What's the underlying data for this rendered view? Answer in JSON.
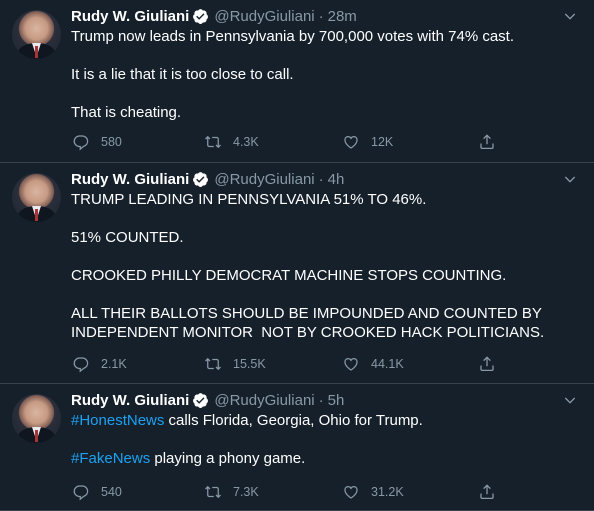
{
  "tweets": [
    {
      "name": "Rudy W. Giuliani",
      "handle": "@RudyGiuliani",
      "dot": "·",
      "time": "28m",
      "paragraphs": [
        [
          {
            "text": "Trump now leads in Pennsylvania by 700,000 votes with 74% cast."
          }
        ],
        [
          {
            "text": "It is a lie that it is too close to call."
          }
        ],
        [
          {
            "text": "That is cheating."
          }
        ]
      ],
      "replies": "580",
      "retweets": "4.3K",
      "likes": "12K"
    },
    {
      "name": "Rudy W. Giuliani",
      "handle": "@RudyGiuliani",
      "dot": "·",
      "time": "4h",
      "paragraphs": [
        [
          {
            "text": "TRUMP LEADING IN PENNSYLVANIA 51% TO 46%."
          }
        ],
        [
          {
            "text": "51% COUNTED."
          }
        ],
        [
          {
            "text": "CROOKED PHILLY DEMOCRAT MACHINE STOPS COUNTING."
          }
        ],
        [
          {
            "text": "ALL THEIR BALLOTS SHOULD BE IMPOUNDED AND COUNTED BY\nINDEPENDENT MONITOR  NOT BY CROOKED HACK POLITICIANS."
          }
        ]
      ],
      "replies": "2.1K",
      "retweets": "15.5K",
      "likes": "44.1K"
    },
    {
      "name": "Rudy W. Giuliani",
      "handle": "@RudyGiuliani",
      "dot": "·",
      "time": "5h",
      "paragraphs": [
        [
          {
            "text": "#HonestNews",
            "hashtag": true
          },
          {
            "text": " calls Florida, Georgia, Ohio for Trump."
          }
        ],
        [
          {
            "text": "#FakeNews",
            "hashtag": true
          },
          {
            "text": " playing a phony game."
          }
        ]
      ],
      "replies": "540",
      "retweets": "7.3K",
      "likes": "31.2K"
    }
  ],
  "colors": {
    "background": "#15202b",
    "secondary_text": "#8899a6",
    "link": "#1da1f2",
    "divider": "#38444d",
    "verified": "#ffffff"
  },
  "icons": [
    "chevron-down-icon",
    "verified-badge-icon",
    "reply-icon",
    "retweet-icon",
    "like-icon",
    "share-icon"
  ]
}
